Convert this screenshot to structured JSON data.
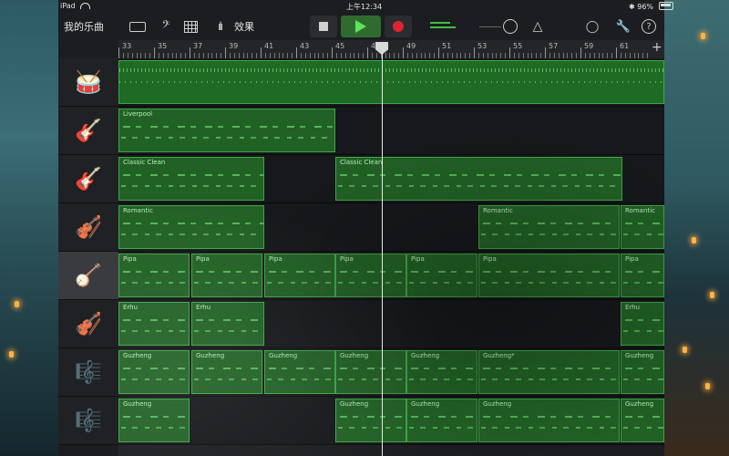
{
  "status_bar": {
    "device": "iPad",
    "time": "上午12:34",
    "battery": "96%"
  },
  "toolbar": {
    "my_songs": "我的乐曲",
    "effects": "效果"
  },
  "ruler": {
    "bars": [
      "33",
      "35",
      "37",
      "39",
      "41",
      "43",
      "45",
      "47",
      "49",
      "51",
      "53",
      "55",
      "57",
      "59",
      "61"
    ]
  },
  "tracks": [
    {
      "instrument": "drum-kit",
      "regions": [
        {
          "label": ""
        }
      ]
    },
    {
      "instrument": "electric-guitar",
      "regions": [
        {
          "label": "Liverpool"
        }
      ]
    },
    {
      "instrument": "hollow-guitar",
      "regions": [
        {
          "label": "Classic Clean"
        },
        {
          "label": "Classic Clean"
        }
      ]
    },
    {
      "instrument": "strings",
      "regions": [
        {
          "label": "Romantic"
        },
        {
          "label": "Romantic"
        },
        {
          "label": "Romantic"
        }
      ]
    },
    {
      "instrument": "pipa",
      "regions": [
        {
          "label": "Pipa"
        },
        {
          "label": "Pipa"
        },
        {
          "label": "Pipa"
        },
        {
          "label": "Pipa"
        },
        {
          "label": "Pipa"
        },
        {
          "label": "Pipa"
        },
        {
          "label": "Pipa"
        }
      ]
    },
    {
      "instrument": "erhu",
      "regions": [
        {
          "label": "Erhu"
        },
        {
          "label": "Erhu"
        },
        {
          "label": "Erhu"
        }
      ]
    },
    {
      "instrument": "guzheng",
      "regions": [
        {
          "label": "Guzheng"
        },
        {
          "label": "Guzheng"
        },
        {
          "label": "Guzheng"
        },
        {
          "label": "Guzheng"
        },
        {
          "label": "Guzheng"
        },
        {
          "label": "Guzheng*"
        },
        {
          "label": "Guzheng"
        }
      ]
    },
    {
      "instrument": "guzheng",
      "regions": [
        {
          "label": "Guzheng"
        },
        {
          "label": "Guzheng"
        },
        {
          "label": "Guzheng"
        },
        {
          "label": "Guzheng"
        },
        {
          "label": "Guzheng"
        }
      ]
    }
  ],
  "colors": {
    "region": "#256b2a",
    "play": "#5ee35b",
    "record": "#e0242f"
  }
}
